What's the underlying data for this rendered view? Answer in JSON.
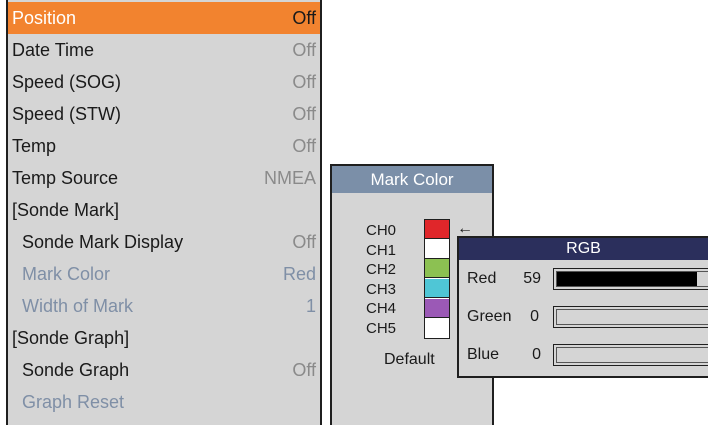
{
  "menu": {
    "items": [
      {
        "label": "Position",
        "value": "Off",
        "state": "selected",
        "indent": false
      },
      {
        "label": "Date Time",
        "value": "Off",
        "state": "normal",
        "indent": false
      },
      {
        "label": "Speed (SOG)",
        "value": "Off",
        "state": "normal",
        "indent": false
      },
      {
        "label": "Speed (STW)",
        "value": "Off",
        "state": "normal",
        "indent": false
      },
      {
        "label": "Temp",
        "value": "Off",
        "state": "normal",
        "indent": false
      },
      {
        "label": "Temp Source",
        "value": "NMEA",
        "state": "normal",
        "indent": false
      },
      {
        "label": "[Sonde Mark]",
        "value": "",
        "state": "normal",
        "indent": false
      },
      {
        "label": "Sonde Mark Display",
        "value": "Off",
        "state": "normal",
        "indent": true
      },
      {
        "label": "Mark Color",
        "value": "Red",
        "state": "disabled",
        "indent": true
      },
      {
        "label": "Width of Mark",
        "value": "1",
        "state": "disabled",
        "indent": true
      },
      {
        "label": "[Sonde Graph]",
        "value": "",
        "state": "normal",
        "indent": false
      },
      {
        "label": "Sonde Graph",
        "value": "Off",
        "state": "normal",
        "indent": true
      },
      {
        "label": "Graph Reset",
        "value": "",
        "state": "disabled",
        "indent": true
      }
    ],
    "selected_color": "#f2832f"
  },
  "mark_color": {
    "title": "Mark Color",
    "channels": [
      {
        "label": "CH0",
        "color": "#e0262a"
      },
      {
        "label": "CH1",
        "color": "#ffffff"
      },
      {
        "label": "CH2",
        "color": "#8cc152"
      },
      {
        "label": "CH3",
        "color": "#4fc6d6"
      },
      {
        "label": "CH4",
        "color": "#9b59b6"
      },
      {
        "label": "CH5",
        "color": "#ffffff"
      }
    ],
    "arrow": "←",
    "default_label": "Default"
  },
  "rgb": {
    "title": "RGB",
    "channels": [
      {
        "name": "Red",
        "value": "59",
        "level": 0.93
      },
      {
        "name": "Green",
        "value": "0",
        "level": 0
      },
      {
        "name": "Blue",
        "value": "0",
        "level": 0
      }
    ]
  }
}
